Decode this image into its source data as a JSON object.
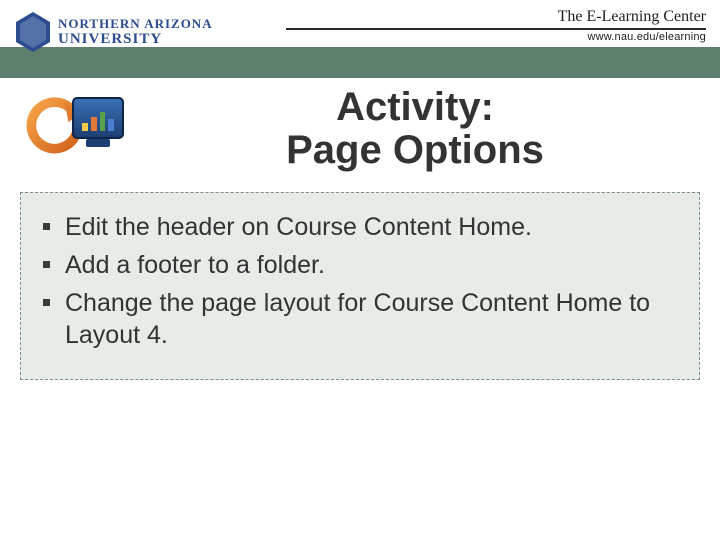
{
  "header": {
    "org_line1": "NORTHERN ARIZONA",
    "org_line2": "UNIVERSITY",
    "center_name": "The E-Learning Center",
    "site_url": "www.nau.edu/elearning"
  },
  "title": {
    "line1": "Activity:",
    "line2": "Page Options"
  },
  "bullets": [
    "Edit the header on Course Content Home.",
    "Add a footer to a folder.",
    "Change the page layout for Course Content Home to Layout 4."
  ]
}
